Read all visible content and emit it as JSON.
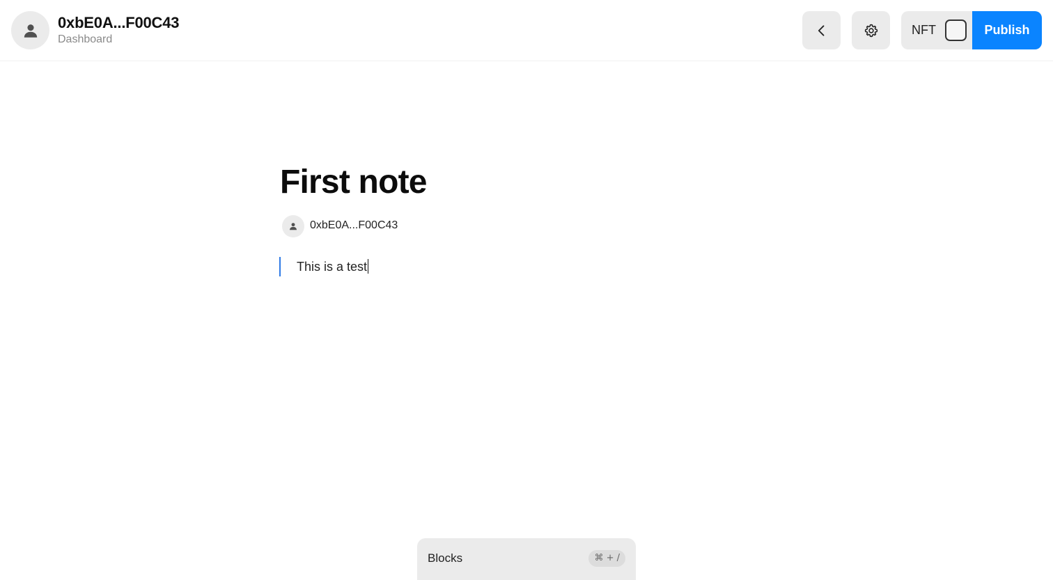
{
  "header": {
    "account_name": "0xbE0A...F00C43",
    "account_subtitle": "Dashboard",
    "nft_label": "NFT",
    "publish_label": "Publish",
    "icons": [
      "user-icon",
      "chevron-left-icon",
      "gear-icon",
      "checkbox-icon"
    ]
  },
  "note": {
    "title": "First note",
    "author": "0xbE0A...F00C43",
    "body": "This is a test"
  },
  "blocks_panel": {
    "label": "Blocks",
    "shortcut": "⌘ + /"
  },
  "colors": {
    "accent": "#0a84ff",
    "block_marker": "#2f7ae5",
    "button_bg": "#ebebeb"
  }
}
